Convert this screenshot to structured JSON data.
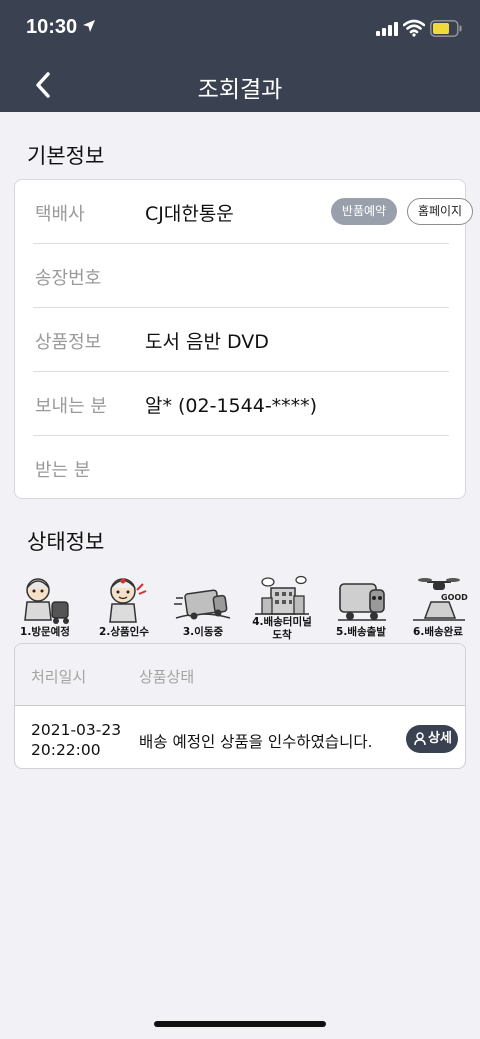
{
  "status_bar": {
    "time": "10:30",
    "icons": [
      "location-arrow-icon",
      "cellular-signal-icon",
      "wifi-icon",
      "battery-icon"
    ],
    "battery_color": "#f2d93a"
  },
  "nav": {
    "title": "조회결과",
    "back_icon": "chevron-left-icon",
    "bg_color": "#3a4150"
  },
  "basic_info": {
    "section_title": "기본정보",
    "rows": [
      {
        "label": "택배사",
        "value": "CJ대한통운"
      },
      {
        "label": "송장번호",
        "value": ""
      },
      {
        "label": "상품정보",
        "value": "도서 음반 DVD"
      },
      {
        "label": "보내는 분",
        "value": "알* (02-1544-****)"
      },
      {
        "label": "받는 분",
        "value": ""
      }
    ],
    "return_button": "반품예약",
    "homepage_button": "홈페이지"
  },
  "status_info": {
    "section_title": "상태정보",
    "steps": [
      {
        "label": "1.방문예정",
        "icon": "courier-with-cart-icon"
      },
      {
        "label": "2.상품인수",
        "icon": "courier-waving-icon"
      },
      {
        "label": "3.이동중",
        "icon": "truck-moving-icon"
      },
      {
        "label": "4.배송터미널 도착",
        "line1": "4.배송터미널",
        "line2": "도착",
        "icon": "terminal-building-icon"
      },
      {
        "label": "5.배송출발",
        "icon": "truck-departing-icon"
      },
      {
        "label": "6.배송완료",
        "icon": "drone-delivered-icon"
      }
    ],
    "table": {
      "headers": [
        "처리일시",
        "상품상태"
      ],
      "rows": [
        {
          "date_line1": "2021-03-23",
          "date_line2": "20:22:00",
          "status": "배송 예정인 상품을 인수하였습니다.",
          "button": "상세"
        }
      ]
    }
  }
}
